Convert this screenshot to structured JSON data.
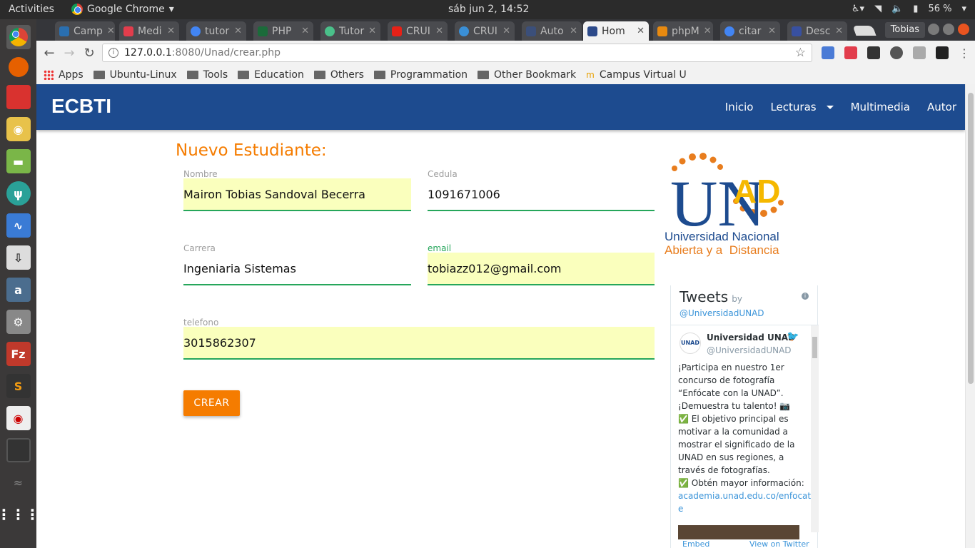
{
  "topbar": {
    "activities": "Activities",
    "app_name": "Google Chrome",
    "clock": "sáb jun  2, 14:52",
    "battery": "56 %"
  },
  "tabs": [
    {
      "label": "Camp",
      "color": "#2a6fb0"
    },
    {
      "label": "Medi",
      "color": "#e23d4c"
    },
    {
      "label": "tutor",
      "color": "#4285f4"
    },
    {
      "label": "PHP",
      "color": "#1b6b3a"
    },
    {
      "label": "Tutor",
      "color": "#4ac08a"
    },
    {
      "label": "CRUI",
      "color": "#e62117"
    },
    {
      "label": "CRUI",
      "color": "#3a8fd6"
    },
    {
      "label": "Auto",
      "color": "#3b4f7a"
    },
    {
      "label": "Hom",
      "color": "#2c4a8a"
    },
    {
      "label": "phpM",
      "color": "#e88a10"
    },
    {
      "label": "citar",
      "color": "#4285f4"
    },
    {
      "label": "Desc",
      "color": "#3850a0"
    }
  ],
  "user_button": "Tobias",
  "omnibox": {
    "host": "127.0.0.1",
    "path": ":8080/Unad/crear.php"
  },
  "bookmarks": [
    "Apps",
    "Ubuntu-Linux",
    "Tools",
    "Education",
    "Others",
    "Programmation",
    "Other Bookmark",
    "Campus Virtual U"
  ],
  "site": {
    "brand": "ECBTI",
    "menu": [
      "Inicio",
      "Lecturas",
      "Multimedia",
      "Autor"
    ]
  },
  "form": {
    "title": "Nuevo Estudiante:",
    "nombre_label": "Nombre",
    "nombre_value": "Mairon Tobias Sandoval Becerra",
    "cedula_label": "Cedula",
    "cedula_value": "1091671006",
    "carrera_label": "Carrera",
    "carrera_value": "Ingeniaria Sistemas",
    "email_label": "email",
    "email_value": "tobiazz012@gmail.com",
    "telefono_label": "telefono",
    "telefono_value": "3015862307",
    "submit": "CREAR"
  },
  "logo": {
    "line1": "Universidad Nacional",
    "line2": "Abierta y a  Distancia",
    "un": "UN",
    "ad": "AD"
  },
  "tweets": {
    "title": "Tweets",
    "by": "by",
    "account": "@UniversidadUNAD",
    "name": "Universidad UNAD",
    "handle": "@UniversidadUNAD",
    "text": [
      "¡Participa en nuestro 1er",
      "concurso de fotografía",
      "“Enfócate con la UNAD”.",
      "¡Demuestra tu talento! 📷",
      "✅ El objetivo principal es",
      "motivar a la comunidad a",
      "mostrar el significado de la",
      "UNAD en sus regiones, a",
      "través de fotografías.",
      "✅ Obtén mayor información:"
    ],
    "link": [
      "academia.unad.edu.co/enfocat",
      "e"
    ],
    "embed": "Embed",
    "view": "View on Twitter"
  }
}
